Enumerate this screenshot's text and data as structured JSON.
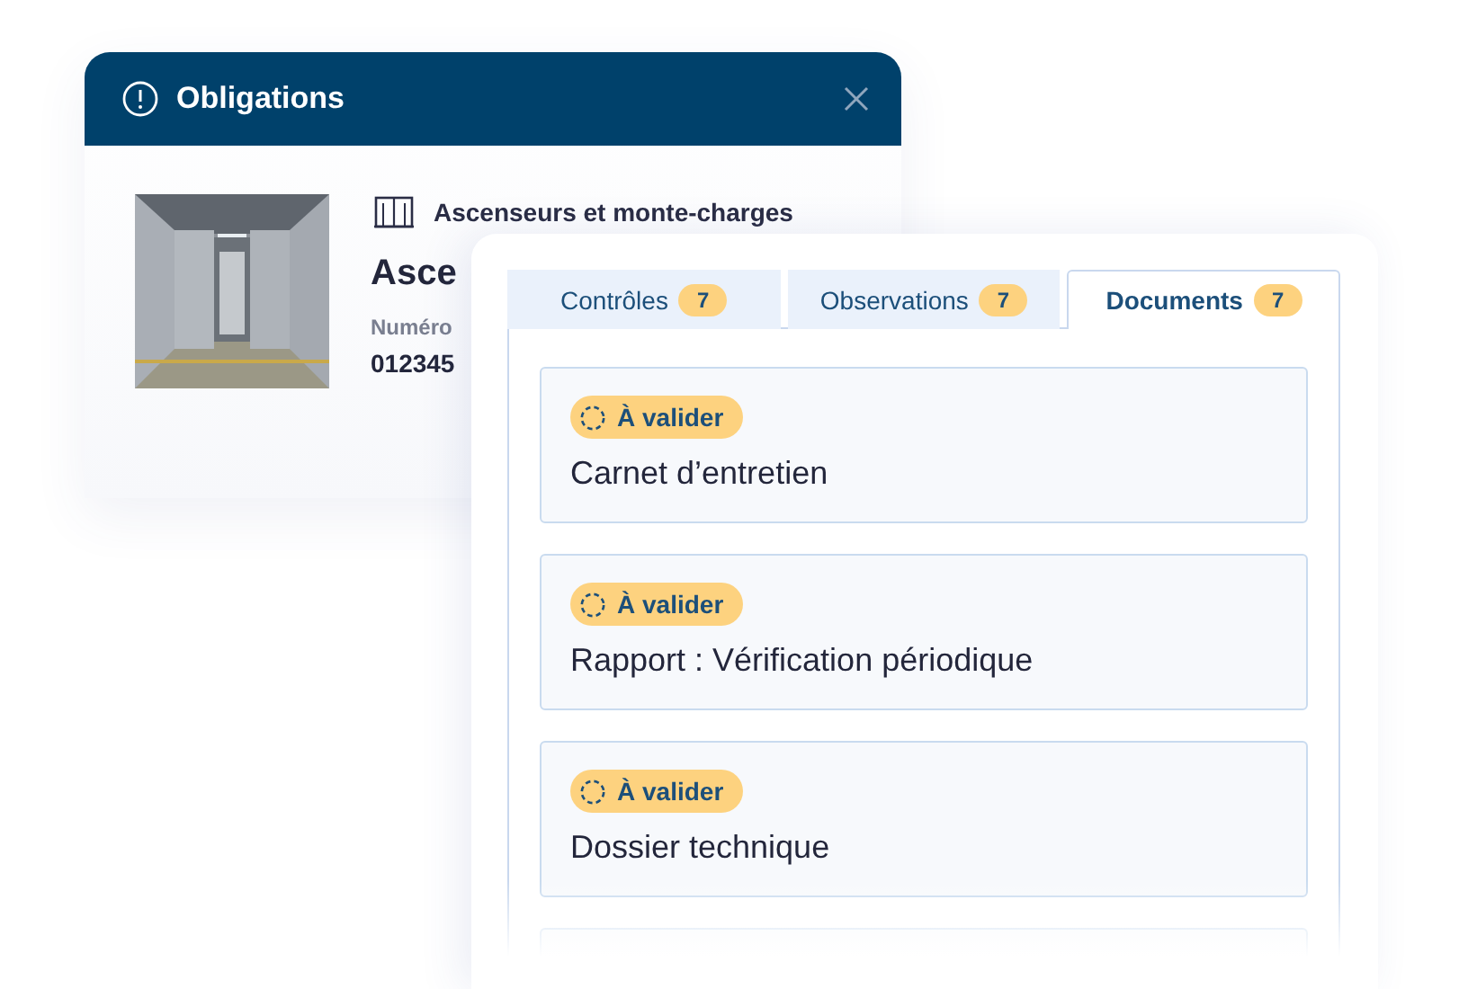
{
  "dialog": {
    "title": "Obligations",
    "category": "Ascenseurs et monte-charges",
    "equipment_name": "Asce",
    "number_label": "Numéro",
    "number_value": "012345"
  },
  "tabs": [
    {
      "label": "Contrôles",
      "count": "7",
      "selected": false
    },
    {
      "label": "Observations",
      "count": "7",
      "selected": false
    },
    {
      "label": "Documents",
      "count": "7",
      "selected": true
    }
  ],
  "documents": [
    {
      "status": "À valider",
      "title": "Carnet d’entretien"
    },
    {
      "status": "À valider",
      "title": "Rapport : Vérification périodique"
    },
    {
      "status": "À valider",
      "title": "Dossier technique"
    }
  ]
}
